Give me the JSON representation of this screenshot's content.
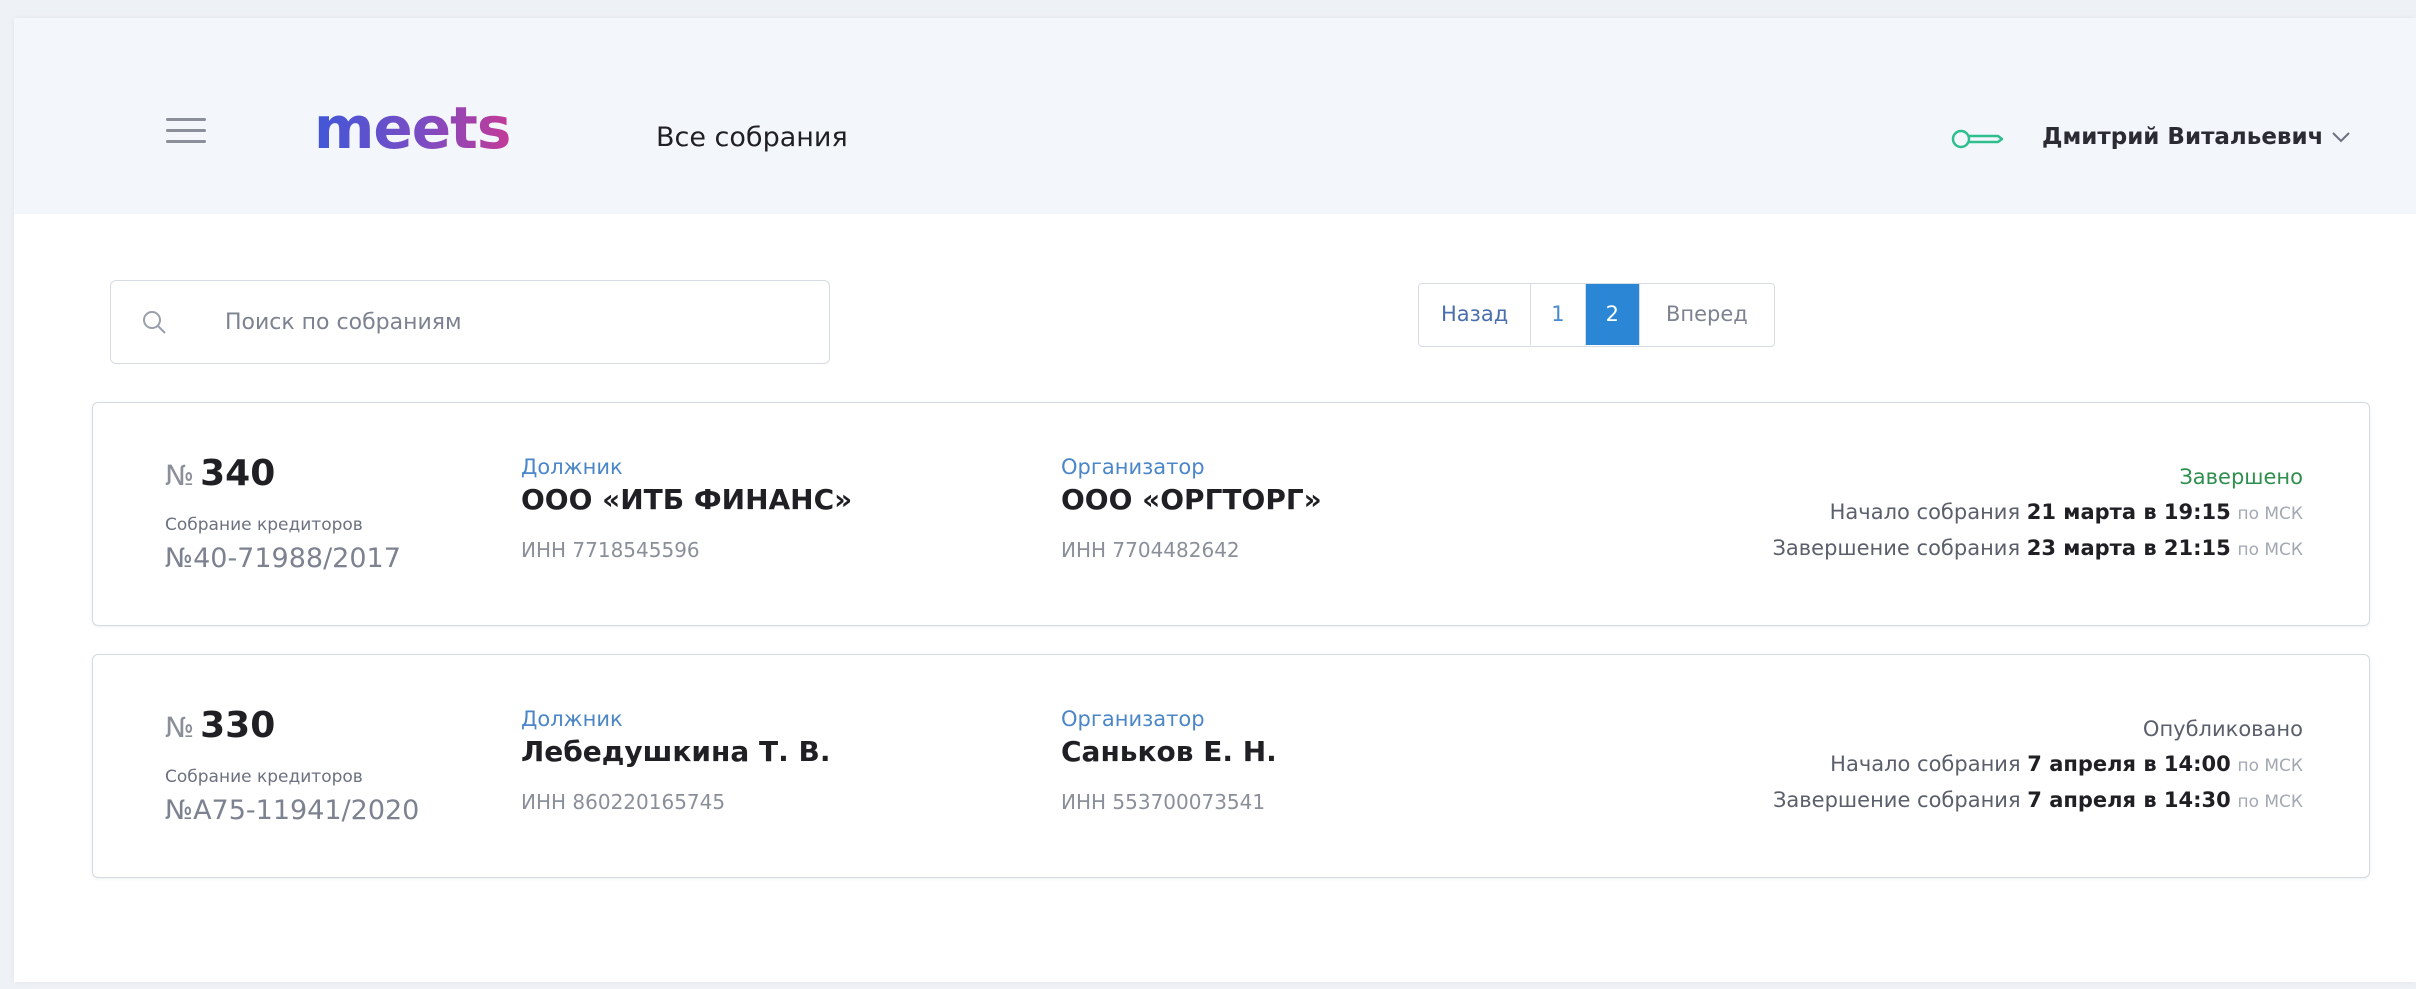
{
  "header": {
    "logo": "meets",
    "title": "Все собрания",
    "user_name": "Дмитрий Витальевич"
  },
  "search": {
    "placeholder": "Поиск по собраниям"
  },
  "pagination": {
    "prev": "Назад",
    "pages": [
      "1",
      "2"
    ],
    "active_page": "2",
    "next": "Вперед"
  },
  "colors": {
    "accent": "#2b86d6",
    "status_done": "#2f8f4e",
    "label": "#4a86c8"
  },
  "meetings": [
    {
      "no_prefix": "№",
      "number": "340",
      "type": "Собрание кредиторов",
      "case": "№40-71988/2017",
      "debtor_label": "Должник",
      "debtor": "ООО «ИТБ ФИНАНС»",
      "debtor_inn": "ИНН  7718545596",
      "org_label": "Организатор",
      "organizer": "ООО «ОРГТОРГ»",
      "org_inn": "ИНН  7704482642",
      "status": "Завершено",
      "start_label": "Начало собрания",
      "start": "21 марта в 19:15",
      "end_label": "Завершение собрания",
      "end": "23 марта в 21:15",
      "tz": "по МСК"
    },
    {
      "no_prefix": "№",
      "number": "330",
      "type": "Собрание кредиторов",
      "case": "№А75-11941/2020",
      "debtor_label": "Должник",
      "debtor": "Лебедушкина Т. В.",
      "debtor_inn": "ИНН  860220165745",
      "org_label": "Организатор",
      "organizer": "Саньков Е. Н.",
      "org_inn": "ИНН  553700073541",
      "status": "Опубликовано",
      "start_label": "Начало собрания",
      "start": "7 апреля в 14:00",
      "end_label": "Завершение собрания",
      "end": "7 апреля в 14:30",
      "tz": "по МСК"
    }
  ]
}
